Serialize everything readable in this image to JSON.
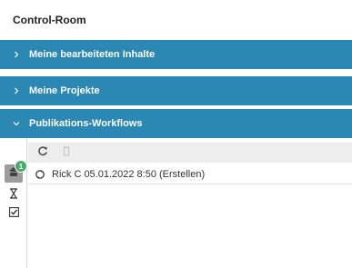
{
  "window": {
    "title": "Control-Room"
  },
  "panels": [
    {
      "label": "Meine bearbeiteten Inhalte",
      "expanded": false,
      "icon": "chevron-right-icon"
    },
    {
      "label": "Meine Projekte",
      "expanded": false,
      "icon": "chevron-right-icon"
    },
    {
      "label": "Publikations-Workflows",
      "expanded": true,
      "icon": "chevron-down-icon"
    }
  ],
  "sidebar": {
    "buttons": [
      {
        "icon": "user-tasks-icon",
        "active": true,
        "badge": "1"
      },
      {
        "icon": "hourglass-icon",
        "active": false
      },
      {
        "icon": "checkbox-checked-icon",
        "active": false
      }
    ]
  },
  "toolbar": {
    "buttons": [
      {
        "icon": "refresh-icon",
        "enabled": true
      },
      {
        "icon": "delete-icon",
        "enabled": false
      }
    ]
  },
  "workflows": [
    {
      "icon": "workflow-cycle-icon",
      "text": "Rick C 05.01.2022 8:50 (Erstellen)"
    }
  ],
  "colors": {
    "panel_bg": "#2b88b5",
    "badge": "#4aa96c",
    "active_button": "#9c9c9c"
  }
}
